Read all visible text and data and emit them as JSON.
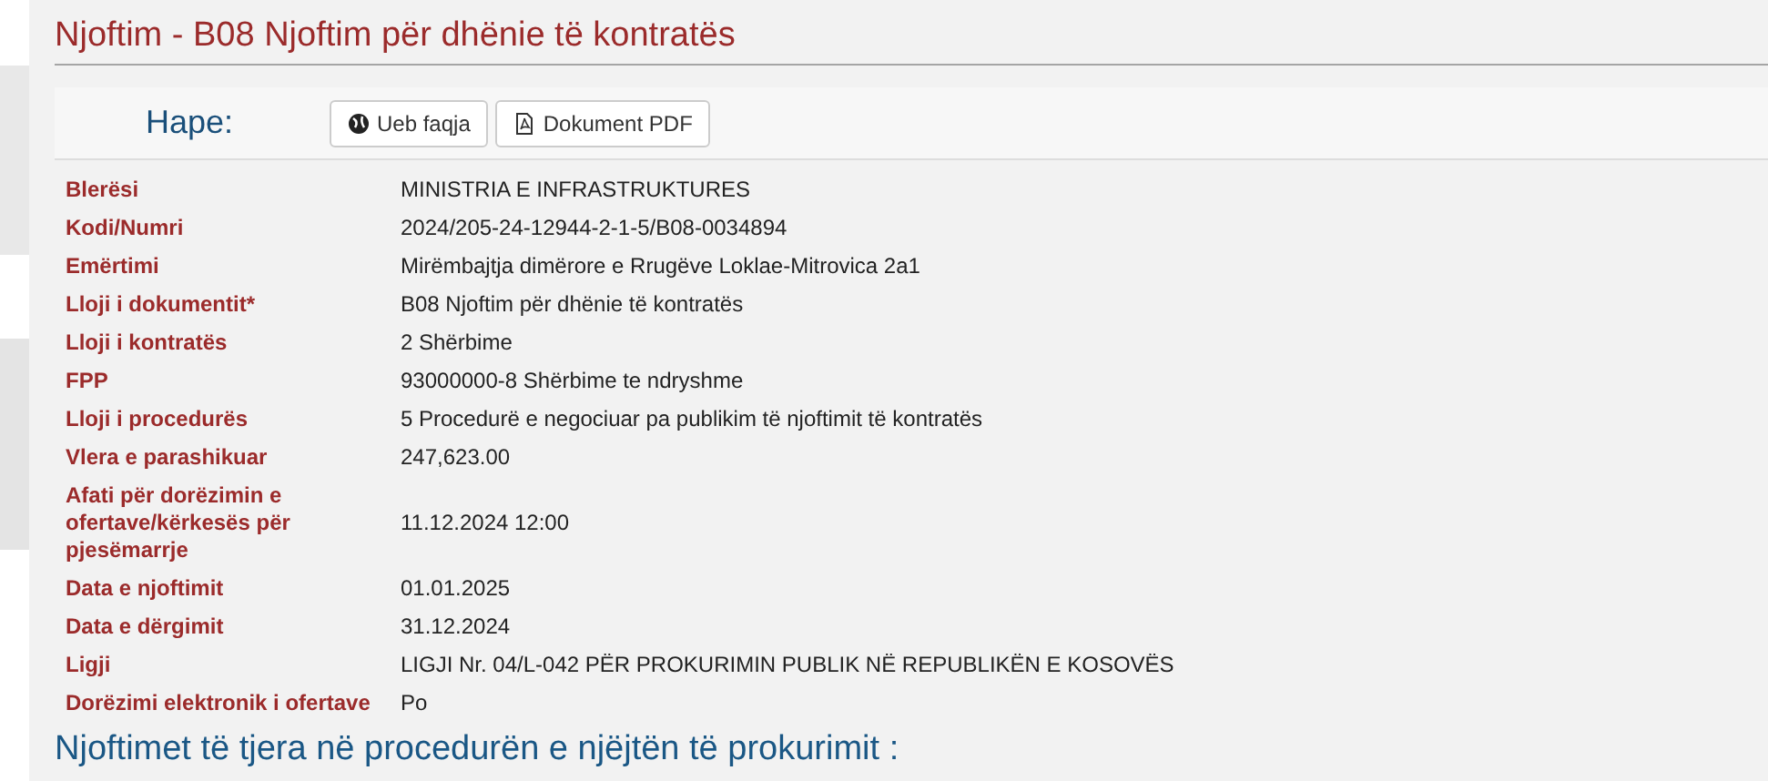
{
  "title": "Njoftim - B08 Njoftim për dhënie të kontratës",
  "open_bar": {
    "label": "Hape:",
    "buttons": [
      {
        "kind": "web",
        "label": "Ueb faqja"
      },
      {
        "kind": "pdf",
        "label": "Dokument PDF"
      }
    ]
  },
  "fields": [
    {
      "label": "Blerësi",
      "value": "MINISTRIA E INFRASTRUKTURES"
    },
    {
      "label": "Kodi/Numri",
      "value": "2024/205-24-12944-2-1-5/B08-0034894"
    },
    {
      "label": "Emërtimi",
      "value": "Mirëmbajtja dimërore e Rrugëve Loklae-Mitrovica 2a1"
    },
    {
      "label": "Lloji i dokumentit*",
      "value": "B08 Njoftim për dhënie të kontratës"
    },
    {
      "label": "Lloji i kontratës",
      "value": "2 Shërbime"
    },
    {
      "label": "FPP",
      "value": "93000000-8 Shërbime te ndryshme"
    },
    {
      "label": "Lloji i procedurës",
      "value": "5 Procedurë e negociuar pa publikim të njoftimit të kontratës"
    },
    {
      "label": "Vlera e parashikuar",
      "value": "247,623.00"
    },
    {
      "label": "Afati për dorëzimin e ofertave/kërkesës për pjesëmarrje",
      "value": "11.12.2024 12:00"
    },
    {
      "label": "Data e njoftimit",
      "value": "01.01.2025"
    },
    {
      "label": "Data e dërgimit",
      "value": "31.12.2024"
    },
    {
      "label": "Ligji",
      "value": "LIGJI Nr. 04/L-042 PËR PROKURIMIN PUBLIK NË REPUBLIKËN E KOSOVËS"
    },
    {
      "label": "Dorëzimi elektronik i ofertave",
      "value": "Po"
    }
  ],
  "section_heading": "Njoftimet të tjera në procedurën e njëjtën të prokurimit :"
}
